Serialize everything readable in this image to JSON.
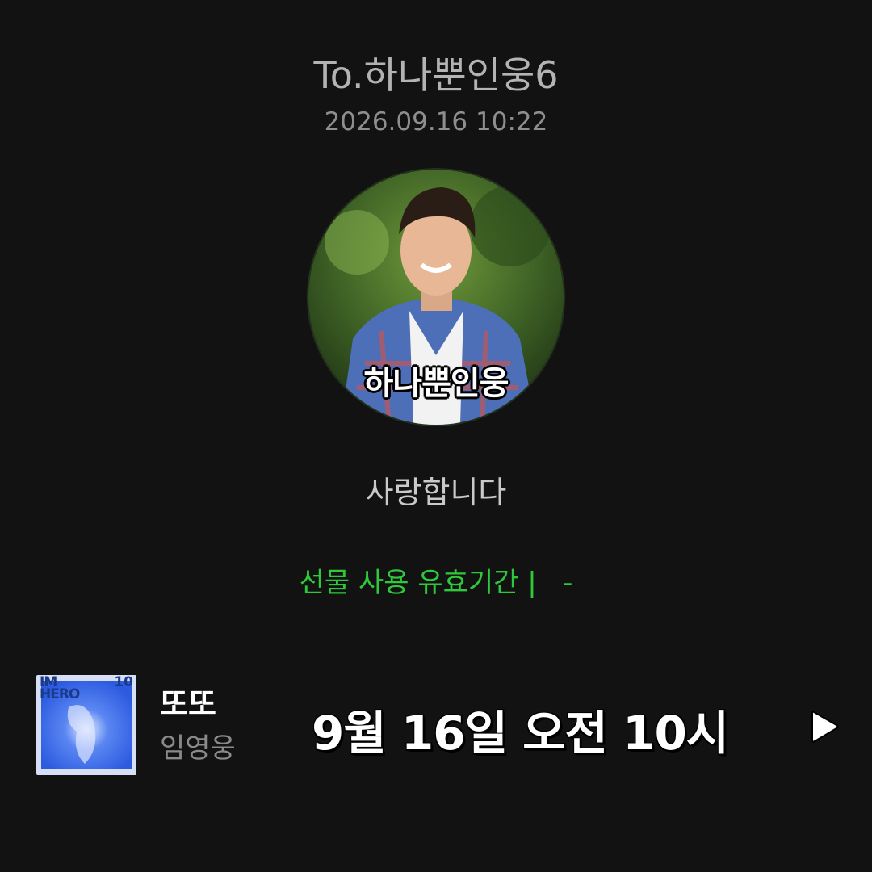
{
  "header": {
    "recipient": "To.하나뿐인웅6",
    "timestamp": "2026.09.16 10:22"
  },
  "profile": {
    "image_caption": "하나뿐인웅"
  },
  "message": "사랑합니다",
  "validity": "선물 사용 유효기간 |   -",
  "music": {
    "album_art_text": "IM\nHERO",
    "album_art_number": "10",
    "title": "또또",
    "artist": "임영웅",
    "release_banner": "9월 16일 오전 10시",
    "play_icon": "play-icon"
  },
  "colors": {
    "background": "#121212",
    "validity_text": "#2ec93a",
    "album_accent": "#2c5be0"
  }
}
